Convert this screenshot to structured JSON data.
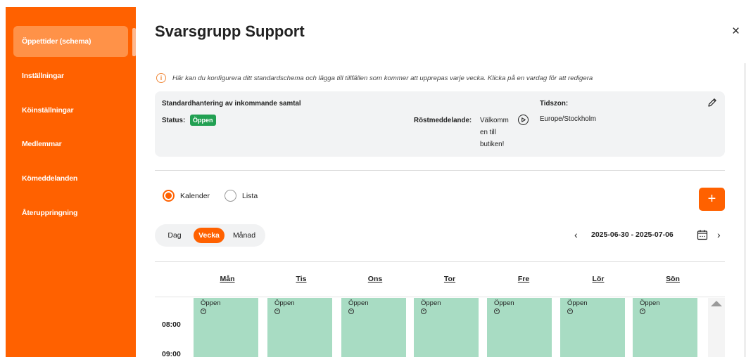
{
  "sidebar": {
    "items": [
      {
        "label": "Öppettider (schema)",
        "active": true
      },
      {
        "label": "Inställningar"
      },
      {
        "label": "Köinställningar"
      },
      {
        "label": "Medlemmar"
      },
      {
        "label": "Kömeddelanden"
      },
      {
        "label": "Återuppringning"
      }
    ]
  },
  "header": {
    "title": "Svarsgrupp Support",
    "close_glyph": "×"
  },
  "info": {
    "icon": "info-icon",
    "text": "Här kan du konfigurera ditt standardschema och lägga till tillfällen som kommer att upprepas varje vecka. Klicka på en vardag för att redigera"
  },
  "card": {
    "heading": "Standardhantering av inkommande samtal",
    "status_label": "Status:",
    "status_value": "Öppen",
    "voice_label": "Röstmeddelande:",
    "voice_value": "Välkomm en till butiken!",
    "timezone_label": "Tidszon:",
    "timezone_value": "Europe/Stockholm"
  },
  "view_mode": {
    "options": [
      {
        "label": "Kalender",
        "selected": true
      },
      {
        "label": "Lista",
        "selected": false
      }
    ],
    "add_glyph": "+"
  },
  "period": {
    "options": [
      {
        "label": "Dag"
      },
      {
        "label": "Vecka",
        "active": true
      },
      {
        "label": "Månad"
      }
    ],
    "prev_glyph": "‹",
    "next_glyph": "›",
    "range": "2025-06-30 - 2025-07-06"
  },
  "calendar": {
    "days": [
      "Mån",
      "Tis",
      "Ons",
      "Tor",
      "Fre",
      "Lör",
      "Sön"
    ],
    "slot_label": "Öppen",
    "times": [
      "08:00",
      "09:00"
    ]
  },
  "colors": {
    "accent": "#ff6100",
    "open_slot": "#a8dcc3",
    "status_badge": "#22a052"
  }
}
